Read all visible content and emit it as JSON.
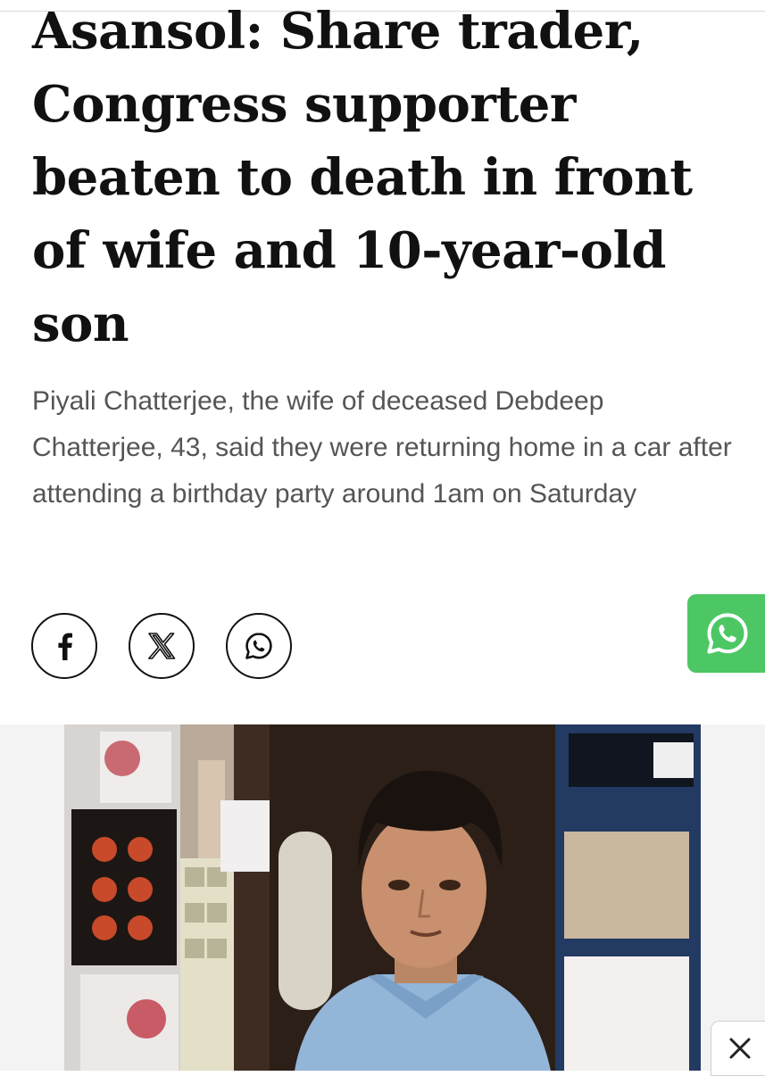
{
  "article": {
    "headline": "Asansol: Share trader, Congress supporter beaten to death in front of wife and 10-year-old son",
    "summary": "Piyali Chatterjee, the wife of deceased Debdeep Chatterjee, 43, said they were returning home in a car after attending a birthday party around 1am on Saturday"
  },
  "share": {
    "buttons": [
      {
        "icon": "facebook-icon"
      },
      {
        "icon": "x-icon"
      },
      {
        "icon": "whatsapp-icon"
      }
    ]
  },
  "floating": {
    "icon": "whatsapp-icon",
    "color": "#4cc764"
  },
  "photo": {
    "subject": "man-in-shop-photo"
  },
  "overlay": {
    "close_icon": "close-icon"
  },
  "colors": {
    "headline": "#111111",
    "summary": "#555555",
    "whatsapp_green": "#4cc764"
  }
}
